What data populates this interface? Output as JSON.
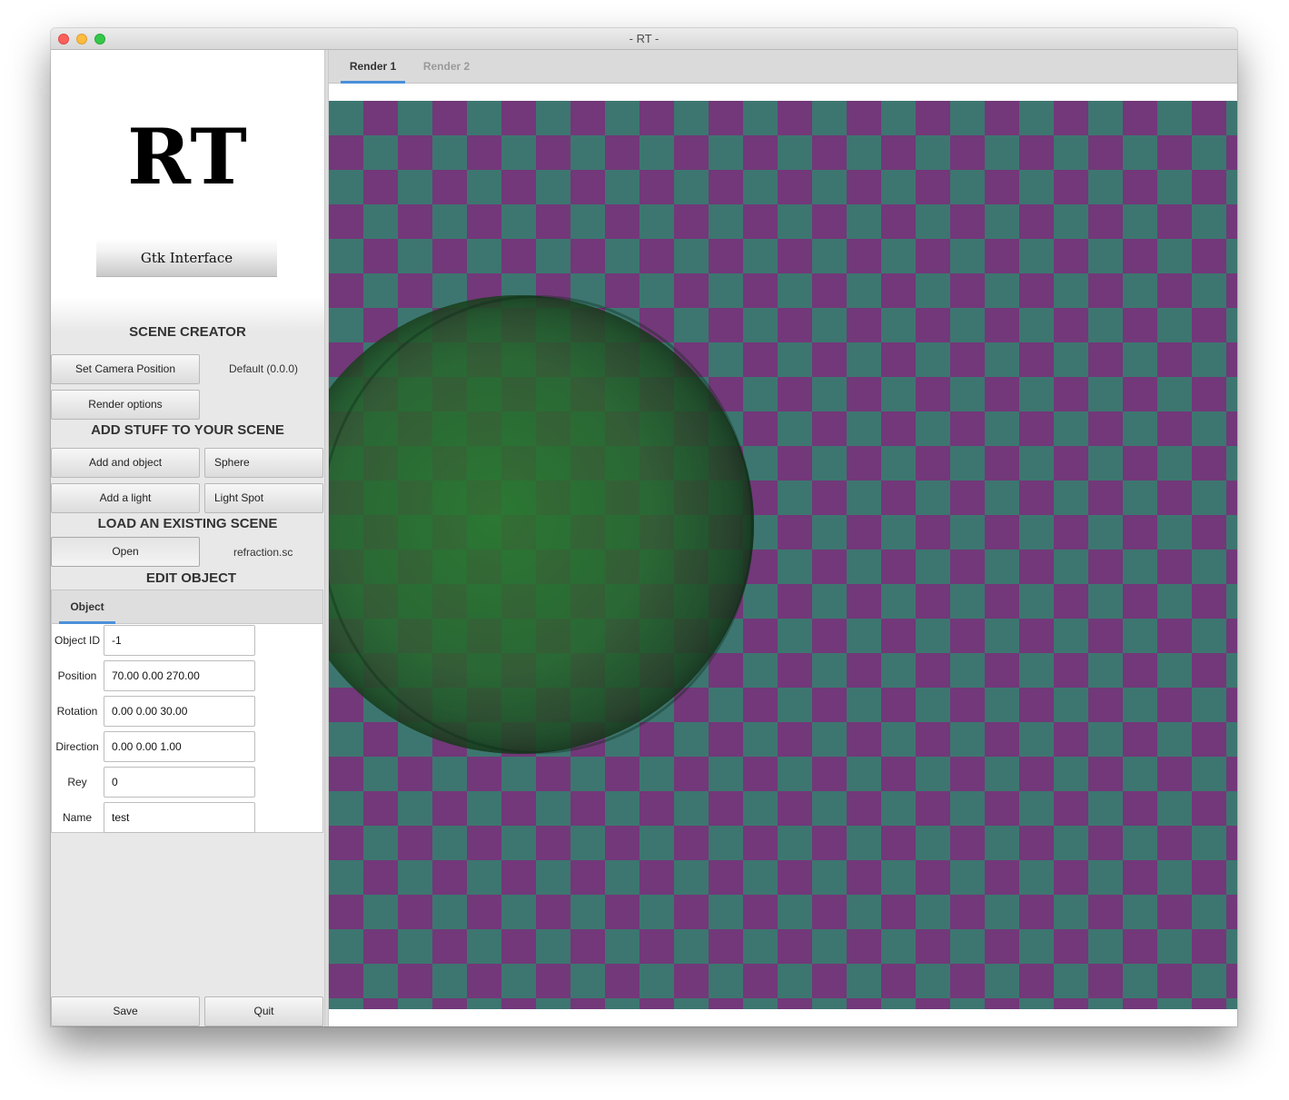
{
  "window": {
    "title": "- RT -"
  },
  "sidebar": {
    "logo": "RT",
    "banner": "Gtk Interface",
    "scene_creator": {
      "title": "SCENE CREATOR",
      "camera_button": "Set Camera Position",
      "camera_value": "Default (0.0.0)",
      "render_options_button": "Render options"
    },
    "add_stuff": {
      "title": "ADD STUFF TO YOUR SCENE",
      "add_object_button": "Add and object",
      "object_type": "Sphere",
      "add_light_button": "Add a light",
      "light_type": "Light Spot"
    },
    "load_scene": {
      "title": "LOAD AN EXISTING SCENE",
      "open_button": "Open",
      "file_name": "refraction.sc"
    },
    "edit_object": {
      "title": "EDIT OBJECT",
      "tab": "Object",
      "fields": [
        {
          "label": "Object ID",
          "value": "-1"
        },
        {
          "label": "Position",
          "value": "70.00 0.00 270.00"
        },
        {
          "label": "Rotation",
          "value": "0.00 0.00 30.00"
        },
        {
          "label": "Direction",
          "value": "0.00 0.00 1.00"
        },
        {
          "label": "Rey",
          "value": "0"
        },
        {
          "label": "Name",
          "value": "test"
        }
      ]
    },
    "footer": {
      "save_button": "Save",
      "quit_button": "Quit"
    }
  },
  "main": {
    "tabs": [
      {
        "label": "Render 1",
        "active": true
      },
      {
        "label": "Render 2",
        "active": false
      }
    ]
  },
  "colors": {
    "accent": "#4a90d9",
    "checker_purple": "#723879",
    "checker_teal": "#3d7670",
    "sphere_green": "#2e6b30"
  }
}
